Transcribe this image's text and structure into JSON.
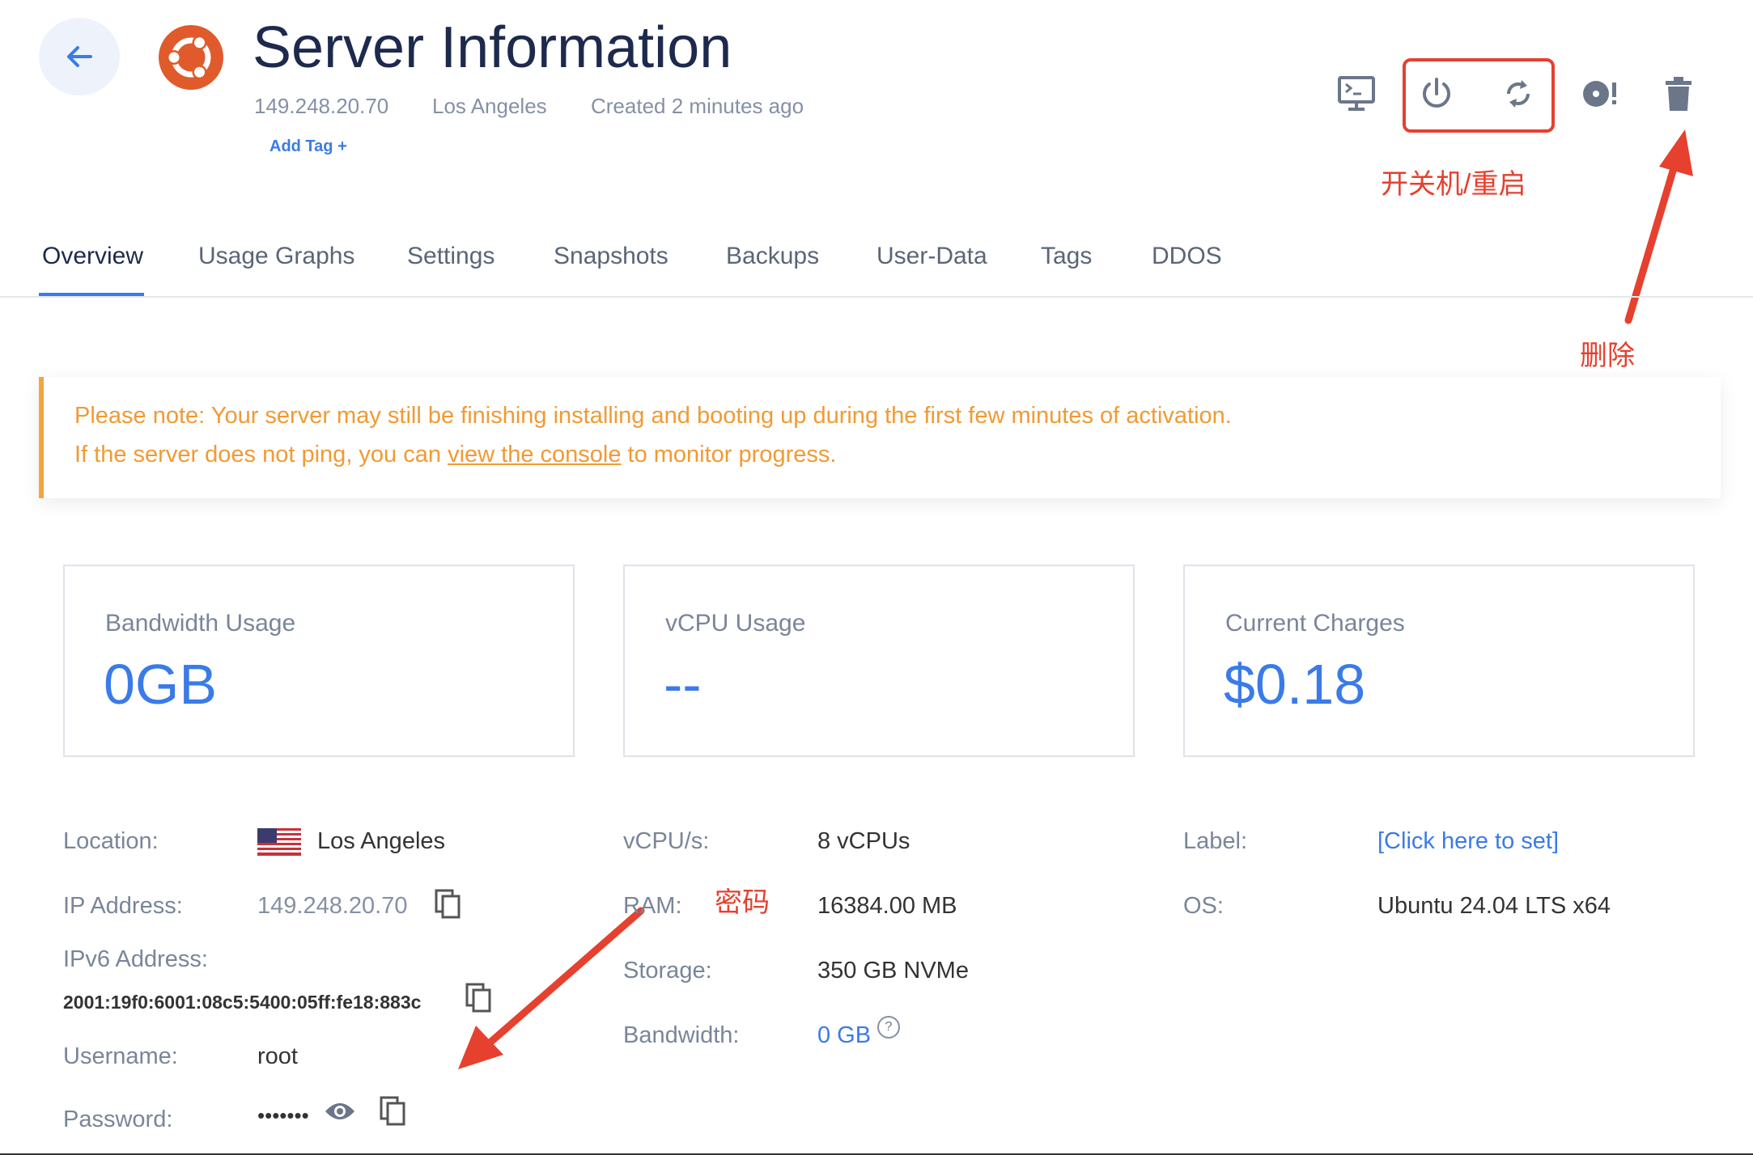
{
  "header": {
    "title": "Server Information",
    "ip": "149.248.20.70",
    "location": "Los Angeles",
    "created": "Created 2 minutes ago",
    "add_tag": "Add Tag +",
    "os_logo_icon": "ubuntu-logo-icon"
  },
  "toolbar": {
    "icons": [
      "console-icon",
      "power-icon",
      "restart-icon",
      "iso-icon",
      "trash-icon"
    ]
  },
  "annotations": {
    "power_restart": "开关机/重启",
    "delete": "删除",
    "password": "密码"
  },
  "tabs": [
    {
      "label": "Overview",
      "active": true
    },
    {
      "label": "Usage Graphs"
    },
    {
      "label": "Settings"
    },
    {
      "label": "Snapshots"
    },
    {
      "label": "Backups"
    },
    {
      "label": "User-Data"
    },
    {
      "label": "Tags"
    },
    {
      "label": "DDOS"
    }
  ],
  "notice": {
    "line1": "Please note: Your server may still be finishing installing and booting up during the first few minutes of activation.",
    "line2_before": "If the server does not ping, you can ",
    "line2_link": "view the console",
    "line2_after": " to monitor progress."
  },
  "cards": {
    "bandwidth": {
      "label": "Bandwidth Usage",
      "value": "0GB"
    },
    "vcpu": {
      "label": "vCPU Usage",
      "value": "--"
    },
    "charges": {
      "label": "Current Charges",
      "value": "$0.18"
    }
  },
  "details": {
    "location_label": "Location:",
    "location_value": "Los Angeles",
    "ip_label": "IP Address:",
    "ip_value": "149.248.20.70",
    "ipv6_label": "IPv6 Address:",
    "ipv6_value": "2001:19f0:6001:08c5:5400:05ff:fe18:883c",
    "username_label": "Username:",
    "username_value": "root",
    "password_label": "Password:",
    "password_value": "•••••••",
    "vcpu_label": "vCPU/s:",
    "vcpu_value": "8 vCPUs",
    "ram_label": "RAM:",
    "ram_value": "16384.00 MB",
    "storage_label": "Storage:",
    "storage_value": "350 GB NVMe",
    "bandwidth_label": "Bandwidth:",
    "bandwidth_value": "0 GB",
    "bandwidth_help": "?",
    "label_label": "Label:",
    "label_value": "[Click here to set]",
    "os_label": "OS:",
    "os_value": "Ubuntu 24.04 LTS x64"
  },
  "colors": {
    "accent": "#3a7be8",
    "warning": "#f19a33",
    "annotation": "#e6402f",
    "ubuntu": "#e05a2b"
  }
}
